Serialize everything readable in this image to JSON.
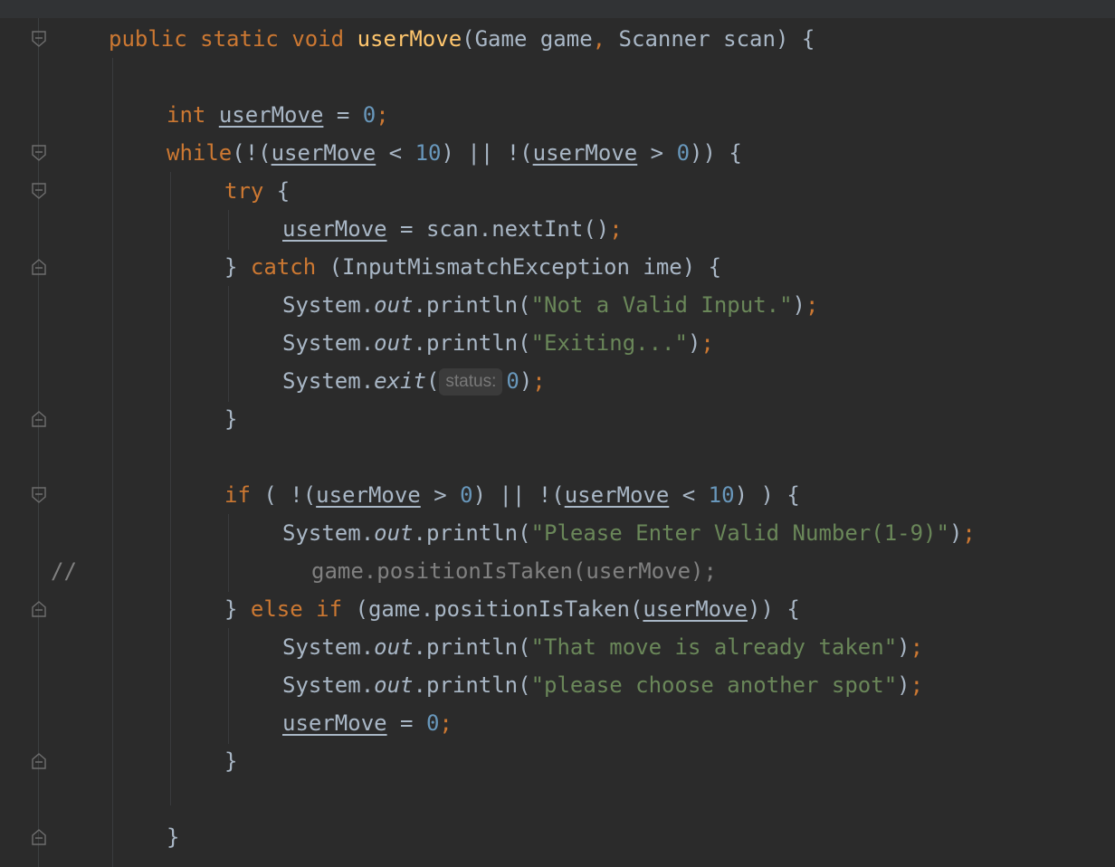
{
  "editor": {
    "language": "Java",
    "colors": {
      "background": "#2b2b2b",
      "keyword": "#cc7832",
      "method": "#ffc66d",
      "number": "#6897bb",
      "string": "#6a8759",
      "text": "#a9b7c6",
      "comment": "#808080"
    },
    "tokens": {
      "public": "public",
      "static": "static",
      "void": "void",
      "method_name": "userMove",
      "params": "(Game game",
      "comma": ",",
      "params2": " Scanner scan) {",
      "int": "int",
      "var": "userMove",
      "assign": " = ",
      "zero": "0",
      "semi": ";",
      "while": "while",
      "open_neg": "(!(",
      "lt": " < ",
      "ten": "10",
      "or_neg": ") || !(",
      "gt": " > ",
      "close_while": ")) {",
      "try": "try",
      "open_brace": " {",
      "scan_call": " = scan.nextInt()",
      "close_brace": "}",
      "catch": "catch",
      "catch_params": " (InputMismatchException ime) {",
      "system": "System.",
      "out": "out",
      "println_open": ".println(",
      "close_paren": ")",
      "str_not_valid": "\"Not a Valid Input.\"",
      "str_exiting": "\"Exiting...\"",
      "exit": "exit",
      "paren_open": "(",
      "status_hint": "status:",
      "if": "if",
      "if_open": " ( !(",
      "if_close": ") ) {",
      "str_enter_valid": "\"Please Enter Valid Number(1-9)\"",
      "comment_marker": "//",
      "commented_code": "game.positionIsTaken(userMove);",
      "else_if": "else if",
      "position_taken_open": " (game.positionIsTaken(",
      "position_taken_close": ")) {",
      "str_taken": "\"That move is already taken\"",
      "str_choose": "\"please choose another spot\""
    }
  }
}
